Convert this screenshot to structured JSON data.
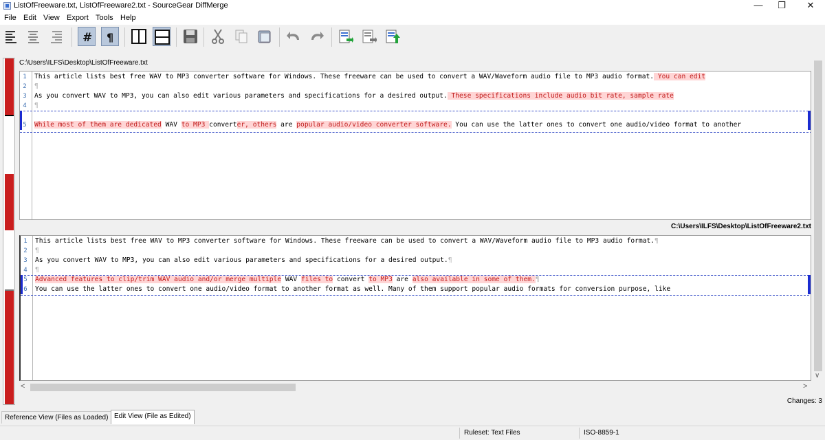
{
  "window": {
    "title": "ListOfFreeware.txt, ListOfFreeware2.txt - SourceGear DiffMerge"
  },
  "menu": [
    "File",
    "Edit",
    "View",
    "Export",
    "Tools",
    "Help"
  ],
  "toolbar": {
    "buttons": [
      "align-left-icon",
      "align-center-icon",
      "align-right-icon",
      "line-numbers-icon",
      "pilcrow-icon",
      "two-pane-vertical-icon",
      "two-pane-horizontal-icon",
      "save-icon",
      "cut-icon",
      "copy-icon",
      "paste-icon",
      "undo-icon",
      "redo-icon",
      "apply-change-icon",
      "export-icon",
      "apply-all-icon"
    ],
    "active": [
      "line-numbers-icon",
      "pilcrow-icon",
      "two-pane-horizontal-icon"
    ]
  },
  "top_pane": {
    "path": "C:\\Users\\ILFS\\Desktop\\ListOfFreeware.txt",
    "lines": [
      {
        "n": "1",
        "parts": [
          {
            "t": "This article lists best free WAV to MP3 converter software for Windows. These freeware can be used to convert a WAV/Waveform audio file to MP3 audio format."
          },
          {
            "t": " You can edit",
            "hl": true
          }
        ]
      },
      {
        "n": "2",
        "parts": [
          {
            "t": "¶",
            "p": true
          }
        ]
      },
      {
        "n": "3",
        "parts": [
          {
            "t": "As you convert WAV to MP3, you can also edit various parameters and specifications for a desired output."
          },
          {
            "t": " These specifications include audio bit rate, sample rate",
            "hl": true
          }
        ]
      },
      {
        "n": "4",
        "parts": [
          {
            "t": "¶",
            "p": true
          }
        ]
      },
      {
        "n": "5",
        "parts": [
          {
            "t": "While most of them are dedicated",
            "hl": true
          },
          {
            "t": " WAV "
          },
          {
            "t": "to MP3 ",
            "hl": true
          },
          {
            "t": "convert"
          },
          {
            "t": "er, others",
            "hl": true
          },
          {
            "t": " are "
          },
          {
            "t": "popular audio/video converter software.",
            "hl": true
          },
          {
            "t": " You can use the latter ones to convert one audio/video format to another"
          }
        ]
      }
    ]
  },
  "bottom_pane": {
    "path": "C:\\Users\\ILFS\\Desktop\\ListOfFreeware2.txt",
    "lines": [
      {
        "n": "1",
        "parts": [
          {
            "t": "This article lists best free WAV to MP3 converter software for Windows. These freeware can be used to convert a WAV/Waveform audio file to MP3 audio format."
          },
          {
            "t": "¶",
            "p": true
          }
        ]
      },
      {
        "n": "2",
        "parts": [
          {
            "t": "¶",
            "p": true
          }
        ]
      },
      {
        "n": "3",
        "parts": [
          {
            "t": "As you convert WAV to MP3, you can also edit various parameters and specifications for a desired output."
          },
          {
            "t": "¶",
            "p": true
          }
        ]
      },
      {
        "n": "4",
        "parts": [
          {
            "t": "¶",
            "p": true
          }
        ]
      },
      {
        "n": "5",
        "parts": [
          {
            "t": "Advanced features to clip/trim WAV audio and/or merge multiple",
            "hl": true
          },
          {
            "t": " WAV "
          },
          {
            "t": "files to",
            "hl": true
          },
          {
            "t": " convert "
          },
          {
            "t": "to MP3",
            "hl": true
          },
          {
            "t": " are "
          },
          {
            "t": "also available in some of them.",
            "hl": true
          },
          {
            "t": "¶",
            "p": true
          }
        ]
      },
      {
        "n": "6",
        "parts": [
          {
            "t": "You can use the latter ones to convert one audio/video format to another format as well. Many of them support popular audio formats for conversion purpose, like"
          }
        ]
      }
    ]
  },
  "changes": "Changes: 3",
  "tabs": [
    "Reference View (Files as Loaded)",
    "Edit View (File as Edited)"
  ],
  "active_tab": "Edit View (File as Edited)",
  "status": {
    "ruleset": "Ruleset: Text Files",
    "encoding": "ISO-8859-1"
  }
}
